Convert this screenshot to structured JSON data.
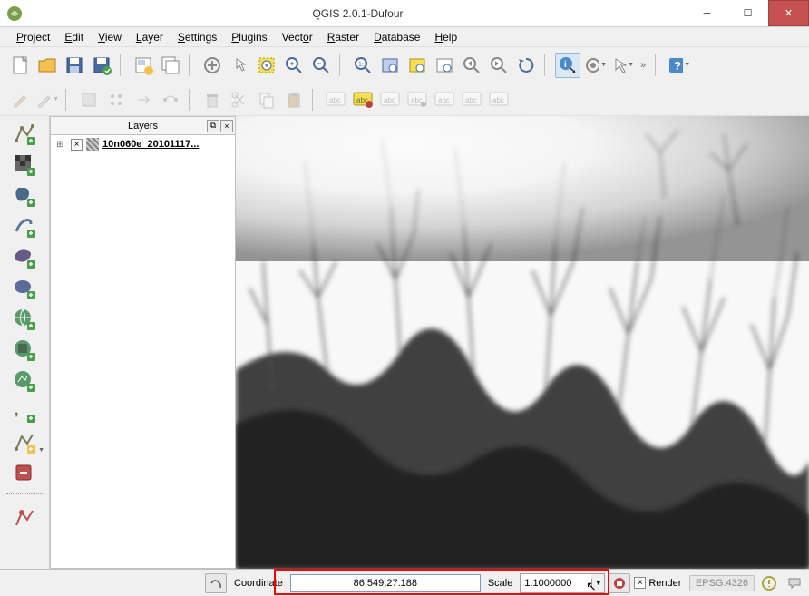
{
  "window": {
    "title": "QGIS 2.0.1-Dufour"
  },
  "menubar": [
    {
      "label": "Project",
      "accel": "P"
    },
    {
      "label": "Edit",
      "accel": "E"
    },
    {
      "label": "View",
      "accel": "V"
    },
    {
      "label": "Layer",
      "accel": "L"
    },
    {
      "label": "Settings",
      "accel": "S"
    },
    {
      "label": "Plugins",
      "accel": "P"
    },
    {
      "label": "Vector",
      "accel": "V"
    },
    {
      "label": "Raster",
      "accel": "R"
    },
    {
      "label": "Database",
      "accel": "D"
    },
    {
      "label": "Help",
      "accel": "H"
    }
  ],
  "layers_panel": {
    "title": "Layers",
    "items": [
      {
        "name": "10n060e_20101117...",
        "checked": true
      }
    ]
  },
  "statusbar": {
    "coordinate_label": "Coordinate",
    "coordinate_value": "86.549,27.188",
    "scale_label": "Scale",
    "scale_value": "1:1000000",
    "render_label": "Render",
    "render_checked": true,
    "crs": "EPSG:4326"
  }
}
